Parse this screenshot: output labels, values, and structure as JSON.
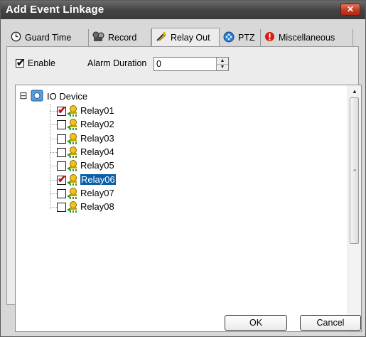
{
  "window": {
    "title": "Add Event Linkage",
    "close_glyph": "✕"
  },
  "tabs": [
    {
      "label": "Guard Time",
      "icon": "clock-icon"
    },
    {
      "label": "Record",
      "icon": "record-icon"
    },
    {
      "label": "Relay Out",
      "icon": "relay-icon",
      "active": true
    },
    {
      "label": "PTZ",
      "icon": "ptz-icon"
    },
    {
      "label": "Miscellaneous",
      "icon": "alert-icon"
    }
  ],
  "relay_out": {
    "enable_label": "Enable",
    "enable_checked": true,
    "alarm_duration_label": "Alarm Duration",
    "alarm_duration_value": "0",
    "tree": {
      "expander": "⊟",
      "root_label": "IO Device",
      "items": [
        {
          "label": "Relay01",
          "checked": true
        },
        {
          "label": "Relay02",
          "checked": false
        },
        {
          "label": "Relay03",
          "checked": false
        },
        {
          "label": "Relay04",
          "checked": false
        },
        {
          "label": "Relay05",
          "checked": false
        },
        {
          "label": "Relay06",
          "checked": true,
          "selected": true
        },
        {
          "label": "Relay07",
          "checked": false
        },
        {
          "label": "Relay08",
          "checked": false
        }
      ]
    }
  },
  "buttons": {
    "ok": "OK",
    "cancel": "Cancel"
  },
  "colors": {
    "selection": "#0a5fa8",
    "check_red": "#cc1111",
    "close_red": "#c8381f"
  }
}
